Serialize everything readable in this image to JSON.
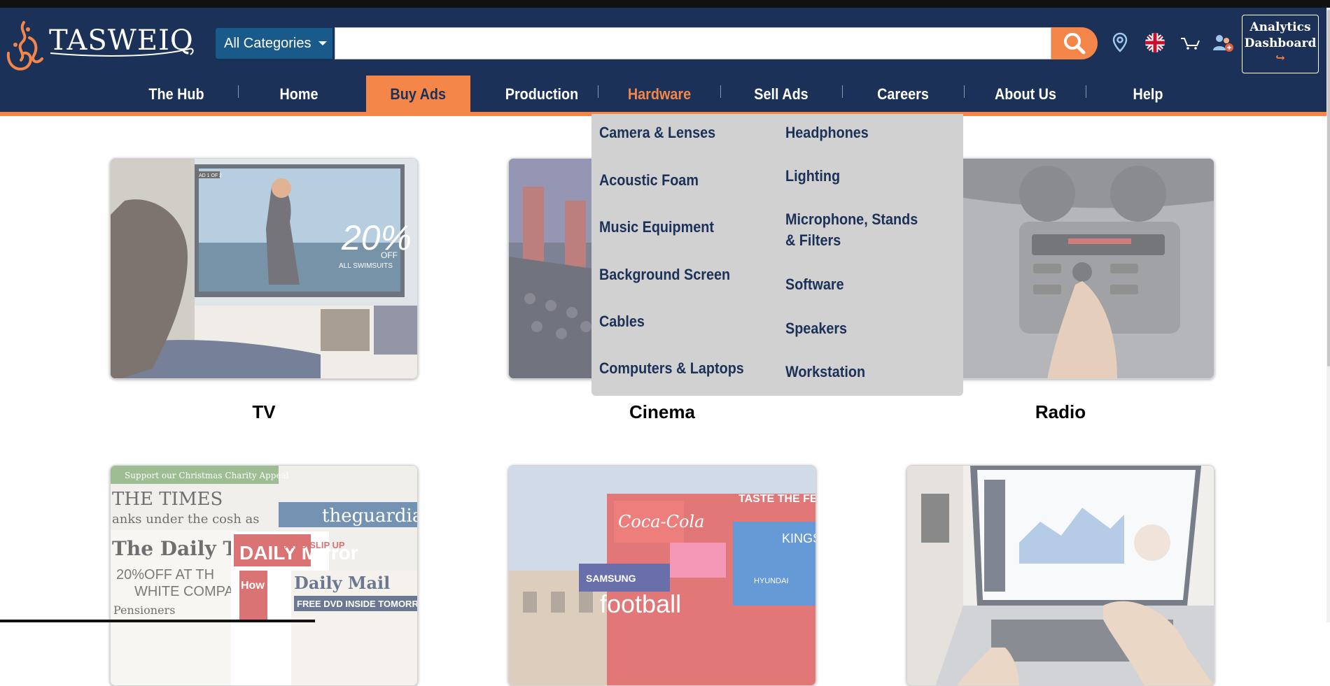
{
  "brand": {
    "name": "TASWEIQ"
  },
  "search": {
    "category": "All Categories",
    "query": "",
    "placeholder": ""
  },
  "header_icons": [
    "location-pin-icon",
    "uk-flag-icon",
    "cart-icon",
    "user-settings-icon"
  ],
  "analytics": {
    "line1": "Analytics",
    "line2": "Dashboard",
    "arrow": "↪"
  },
  "nav": {
    "items": [
      {
        "label": "The Hub"
      },
      {
        "label": "Home"
      },
      {
        "label": "Buy Ads"
      },
      {
        "label": "Production"
      },
      {
        "label": "Hardware"
      },
      {
        "label": "Sell Ads"
      },
      {
        "label": "Careers"
      },
      {
        "label": "About Us"
      },
      {
        "label": "Help"
      }
    ]
  },
  "dropdown": {
    "left": [
      "Camera & Lenses",
      "Acoustic Foam",
      "Music Equipment",
      "Background Screen",
      "Cables",
      "Computers & Laptops"
    ],
    "right": [
      "Headphones",
      "Lighting",
      "Microphone, Stands & Filters",
      "Software",
      "Speakers",
      "Workstation"
    ]
  },
  "categories": [
    {
      "label": "TV"
    },
    {
      "label": "Cinema"
    },
    {
      "label": "Radio"
    },
    {
      "label": ""
    },
    {
      "label": ""
    },
    {
      "label": ""
    }
  ],
  "images": {
    "tv": {
      "ad_counter": "AD 1 OF 2",
      "promo_big": "20%",
      "promo_off": "OFF",
      "promo_sub": "ALL SWIMSUITS"
    },
    "print": {
      "banner": "Support our Christmas Charity Appeal",
      "paper1": "THE TIMES",
      "paper1_sub": "anks under the cosh as",
      "paper2": "theguardian",
      "paper3": "The Daily Tel",
      "paper3_sub1": "20%OFF AT TH",
      "paper3_sub2": "WHITE COMPA",
      "paper3_sub3": "Pensioners",
      "paper4": "DAILY Mirror",
      "paper4_sub": "MAN U SLIP UP",
      "paper4_sub2": "How Fern LOST 5st",
      "paper5": "Daily Mail",
      "paper5_sub": "FREE DVD INSIDE TOMORRO"
    },
    "billboard": {
      "brand1": "Coca-Cola",
      "brand2": "TASTE THE FEEL",
      "brand3": "SAMSUNG",
      "brand4": "football",
      "brand5": "HYUNDAI",
      "brand6": "KINGS LONDO"
    }
  }
}
